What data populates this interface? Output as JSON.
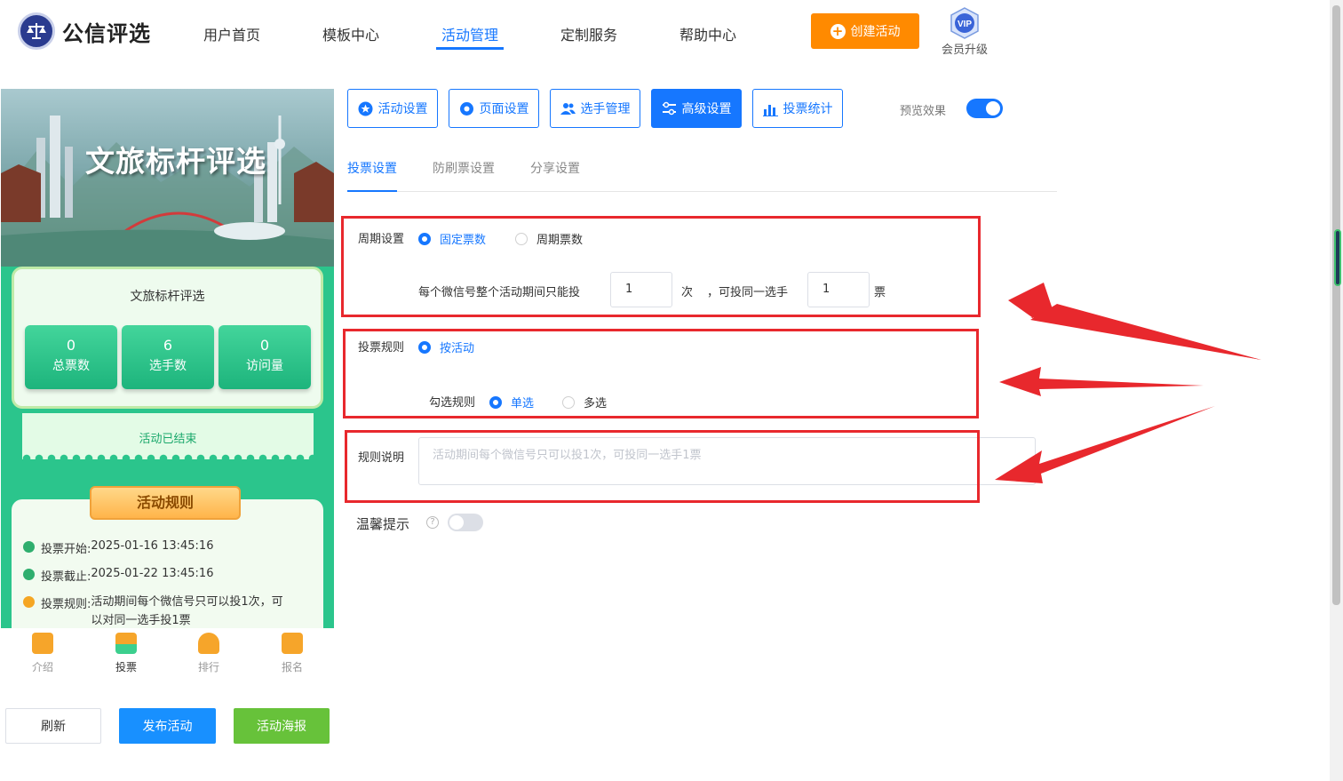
{
  "header": {
    "logo_text": "公信评选",
    "nav": [
      "用户首页",
      "模板中心",
      "活动管理",
      "定制服务",
      "帮助中心"
    ],
    "active_nav": "活动管理",
    "create_button": "创建活动",
    "vip_badge": "VIP",
    "vip_label": "会员升级"
  },
  "preview": {
    "banner_title": "文旅标杆评选",
    "card_title": "文旅标杆评选",
    "stats": [
      {
        "value": "0",
        "label": "总票数"
      },
      {
        "value": "6",
        "label": "选手数"
      },
      {
        "value": "0",
        "label": "访问量"
      }
    ],
    "status": "活动已结束",
    "rules_title": "活动规则",
    "rules": [
      {
        "label": "投票开始:",
        "value": "2025-01-16 13:45:16"
      },
      {
        "label": "投票截止:",
        "value": "2025-01-22 13:45:16"
      },
      {
        "label": "投票规则:",
        "value": "活动期间每个微信号只可以投1次，可",
        "value2": "以对同一选手投1票"
      }
    ],
    "bottom_nav": [
      "介绍",
      "投票",
      "排行",
      "报名"
    ],
    "buttons": {
      "refresh": "刷新",
      "publish": "发布活动",
      "poster": "活动海报"
    }
  },
  "config": {
    "tabs": [
      "活动设置",
      "页面设置",
      "选手管理",
      "高级设置",
      "投票统计"
    ],
    "active_tab": "高级设置",
    "preview_label": "预览效果",
    "preview_on": true,
    "subtabs": [
      "投票设置",
      "防刷票设置",
      "分享设置"
    ],
    "active_subtab": "投票设置",
    "cycle": {
      "label": "周期设置",
      "options": [
        "固定票数",
        "周期票数"
      ],
      "selected": "固定票数",
      "sentence_a": "每个微信号整个活动期间只能投",
      "times_value": "1",
      "unit_a": "次",
      "sentence_b": "，可投同一选手",
      "votes_value": "1",
      "unit_b": "票"
    },
    "rule": {
      "label": "投票规则",
      "option": "按活动",
      "check_label": "勾选规则",
      "check_options": [
        "单选",
        "多选"
      ],
      "check_selected": "单选"
    },
    "description": {
      "label": "规则说明",
      "placeholder": "活动期间每个微信号只可以投1次，可投同一选手1票"
    },
    "tips": {
      "label": "温馨提示",
      "help_icon": "?",
      "enabled": false
    }
  },
  "colors": {
    "primary": "#1677ff",
    "orange": "#ff8a00",
    "green": "#6bc43c",
    "annotation_red": "#e8282d"
  }
}
